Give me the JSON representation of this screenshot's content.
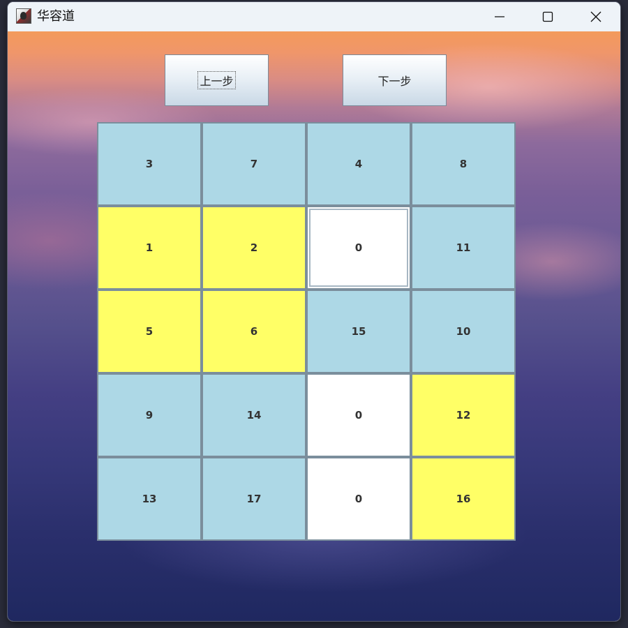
{
  "window": {
    "title": "华容道",
    "icon": "app-icon"
  },
  "controls": {
    "prev_label": "上一步",
    "next_label": "下一步"
  },
  "colors": {
    "blue_tile": "#add8e6",
    "yellow_tile": "#ffff66",
    "empty_tile": "#ffffff",
    "tile_border": "#7b8e9c"
  },
  "board": {
    "rows": [
      [
        {
          "value": "3",
          "color": "blue"
        },
        {
          "value": "7",
          "color": "blue"
        },
        {
          "value": "4",
          "color": "blue"
        },
        {
          "value": "8",
          "color": "blue"
        }
      ],
      [
        {
          "value": "1",
          "color": "yellow"
        },
        {
          "value": "2",
          "color": "yellow"
        },
        {
          "value": "0",
          "color": "white"
        },
        {
          "value": "11",
          "color": "blue"
        }
      ],
      [
        {
          "value": "5",
          "color": "yellow"
        },
        {
          "value": "6",
          "color": "yellow"
        },
        {
          "value": "15",
          "color": "blue"
        },
        {
          "value": "10",
          "color": "blue"
        }
      ],
      [
        {
          "value": "9",
          "color": "blue"
        },
        {
          "value": "14",
          "color": "blue"
        },
        {
          "value": "0",
          "color": "white"
        },
        {
          "value": "12",
          "color": "yellow"
        }
      ],
      [
        {
          "value": "13",
          "color": "blue"
        },
        {
          "value": "17",
          "color": "blue"
        },
        {
          "value": "0",
          "color": "white"
        },
        {
          "value": "16",
          "color": "yellow"
        }
      ]
    ]
  }
}
